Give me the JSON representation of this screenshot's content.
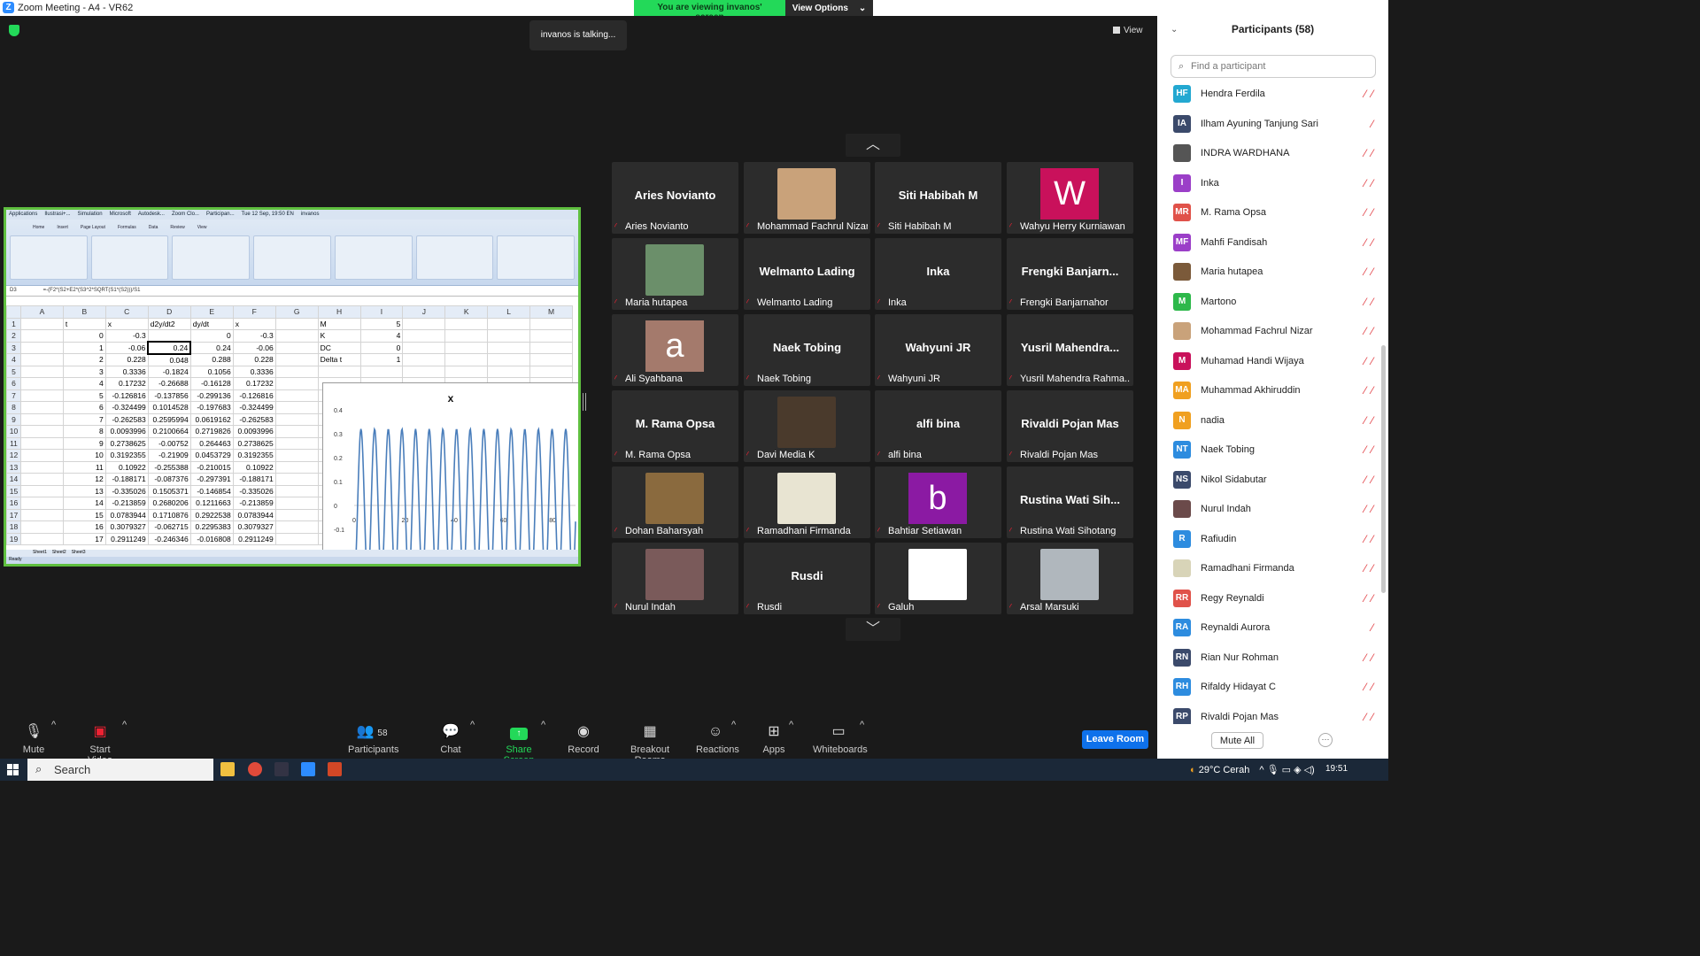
{
  "window": {
    "title": "Zoom Meeting - A4 - VR62",
    "banner_text": "You are viewing invanos' screen",
    "view_options": "View Options"
  },
  "main": {
    "talking": "invanos is talking...",
    "view_label": "View"
  },
  "excel": {
    "taskbar": [
      "Applications",
      "Ilustrasi+...",
      "Simulation",
      "Microsoft",
      "Autodesk...",
      "Zoom Clo...",
      "Participan...",
      "Tue 12 Sep, 19:50 EN",
      "invanos"
    ],
    "ribbon_tabs": [
      "Home",
      "Insert",
      "Page Layout",
      "Formulas",
      "Data",
      "Review",
      "View"
    ],
    "cell_ref": "D3",
    "formula": "=-(F2*(S2+E2*(S3^2*SQRT(S1*(S2)))/S1",
    "columns": [
      "",
      "A",
      "B",
      "C",
      "D",
      "E",
      "F",
      "G",
      "H",
      "I",
      "J",
      "K",
      "L",
      "M"
    ],
    "rows": [
      [
        "1",
        "",
        "t",
        "x",
        "d2y/dt2",
        "dy/dt",
        "x",
        "",
        "M",
        "5",
        "",
        "",
        "",
        ""
      ],
      [
        "2",
        "",
        "0",
        "-0.3",
        "",
        "0",
        "-0.3",
        "",
        "K",
        "4",
        "",
        "",
        "",
        ""
      ],
      [
        "3",
        "",
        "1",
        "-0.06",
        "0.24",
        "0.24",
        "-0.06",
        "",
        "DC",
        "0",
        "",
        "",
        "",
        ""
      ],
      [
        "4",
        "",
        "2",
        "0.228",
        "0.048",
        "0.288",
        "0.228",
        "",
        "Delta t",
        "1",
        "",
        "",
        "",
        ""
      ],
      [
        "5",
        "",
        "3",
        "0.3336",
        "-0.1824",
        "0.1056",
        "0.3336",
        "",
        "",
        "",
        "",
        "",
        "",
        ""
      ],
      [
        "6",
        "",
        "4",
        "0.17232",
        "-0.26688",
        "-0.16128",
        "0.17232",
        "",
        "",
        "",
        "",
        "",
        "",
        ""
      ],
      [
        "7",
        "",
        "5",
        "-0.126816",
        "-0.137856",
        "-0.299136",
        "-0.126816",
        "",
        "",
        "",
        "",
        "",
        "",
        ""
      ],
      [
        "8",
        "",
        "6",
        "-0.324499",
        "0.1014528",
        "-0.197683",
        "-0.324499",
        "",
        "",
        "",
        "",
        "",
        "",
        ""
      ],
      [
        "9",
        "",
        "7",
        "-0.262583",
        "0.2595994",
        "0.0619162",
        "-0.262583",
        "",
        "",
        "",
        "",
        "",
        "",
        ""
      ],
      [
        "10",
        "",
        "8",
        "0.0093996",
        "0.2100664",
        "0.2719826",
        "0.0093996",
        "",
        "",
        "",
        "",
        "",
        "",
        ""
      ],
      [
        "11",
        "",
        "9",
        "0.2738625",
        "-0.00752",
        "0.264463",
        "0.2738625",
        "",
        "",
        "",
        "",
        "",
        "",
        ""
      ],
      [
        "12",
        "",
        "10",
        "0.3192355",
        "-0.21909",
        "0.0453729",
        "0.3192355",
        "",
        "",
        "",
        "",
        "",
        "",
        ""
      ],
      [
        "13",
        "",
        "11",
        "0.10922",
        "-0.255388",
        "-0.210015",
        "0.10922",
        "",
        "",
        "",
        "",
        "",
        "",
        ""
      ],
      [
        "14",
        "",
        "12",
        "-0.188171",
        "-0.087376",
        "-0.297391",
        "-0.188171",
        "",
        "",
        "",
        "",
        "",
        "",
        ""
      ],
      [
        "15",
        "",
        "13",
        "-0.335026",
        "0.1505371",
        "-0.146854",
        "-0.335026",
        "",
        "",
        "",
        "",
        "",
        "",
        ""
      ],
      [
        "16",
        "",
        "14",
        "-0.213859",
        "0.2680206",
        "0.1211663",
        "-0.213859",
        "",
        "",
        "",
        "",
        "",
        "",
        ""
      ],
      [
        "17",
        "",
        "15",
        "0.0783944",
        "0.1710876",
        "0.2922538",
        "0.0783944",
        "",
        "",
        "",
        "",
        "",
        "",
        ""
      ],
      [
        "18",
        "",
        "16",
        "0.3079327",
        "-0.062715",
        "0.2295383",
        "0.3079327",
        "",
        "",
        "",
        "",
        "",
        "",
        ""
      ],
      [
        "19",
        "",
        "17",
        "0.2911249",
        "-0.246346",
        "-0.016808",
        "0.2911249",
        "",
        "",
        "",
        "",
        "",
        "",
        ""
      ]
    ],
    "sheets": [
      "Sheet1",
      "Sheet2",
      "Sheet3"
    ],
    "status": "Ready",
    "chart": {
      "title": "x",
      "y_ticks": [
        "0.4",
        "0.3",
        "0.2",
        "0.1",
        "0",
        "-0.1"
      ],
      "x_ticks": [
        "0",
        "20",
        "40",
        "60",
        "80"
      ]
    }
  },
  "tiles": [
    {
      "name": "Aries Novianto",
      "label": "Aries Novianto",
      "kind": "text"
    },
    {
      "name": "",
      "label": "Mohammad Fachrul Nizar",
      "kind": "pic",
      "color": "#c9a27a"
    },
    {
      "name": "Siti Habibah M",
      "label": "Siti Habibah M",
      "kind": "text"
    },
    {
      "name": "W",
      "label": "Wahyu Herry Kurniawan",
      "kind": "avatar",
      "color": "#c9115b"
    },
    {
      "name": "",
      "label": "Maria hutapea",
      "kind": "pic",
      "color": "#6b8f6a"
    },
    {
      "name": "Welmanto Lading",
      "label": "Welmanto Lading",
      "kind": "text"
    },
    {
      "name": "Inka",
      "label": "Inka",
      "kind": "text"
    },
    {
      "name": "Frengki  Banjarn...",
      "label": "Frengki Banjarnahor",
      "kind": "text"
    },
    {
      "name": "a",
      "label": "Ali Syahbana",
      "kind": "avatar",
      "color": "#a47a6c"
    },
    {
      "name": "Naek Tobing",
      "label": "Naek Tobing",
      "kind": "text"
    },
    {
      "name": "Wahyuni JR",
      "label": "Wahyuni JR",
      "kind": "text"
    },
    {
      "name": "Yusril  Mahendra...",
      "label": "Yusril Mahendra Rahma...",
      "kind": "text"
    },
    {
      "name": "M. Rama Opsa",
      "label": "M. Rama Opsa",
      "kind": "text"
    },
    {
      "name": "",
      "label": "Davi Media K",
      "kind": "pic",
      "color": "#4a3a2c"
    },
    {
      "name": "alfi bina",
      "label": "alfi bina",
      "kind": "text"
    },
    {
      "name": "Rivaldi Pojan Mas",
      "label": "Rivaldi Pojan Mas",
      "kind": "text"
    },
    {
      "name": "",
      "label": "Dohan Baharsyah",
      "kind": "pic",
      "color": "#8a6a3e"
    },
    {
      "name": "",
      "label": "Ramadhani Firmanda",
      "kind": "pic",
      "color": "#e8e4d2"
    },
    {
      "name": "b",
      "label": "Bahtiar Setiawan",
      "kind": "avatar",
      "color": "#8b1aa3"
    },
    {
      "name": "Rustina  Wati  Sih...",
      "label": "Rustina Wati Sihotang",
      "kind": "text"
    },
    {
      "name": "",
      "label": "Nurul Indah",
      "kind": "pic",
      "color": "#7a5a5a"
    },
    {
      "name": "Rusdi",
      "label": "Rusdi",
      "kind": "text"
    },
    {
      "name": "",
      "label": "Galuh",
      "kind": "pic",
      "color": "#ffffff"
    },
    {
      "name": "",
      "label": "Arsal Marsuki",
      "kind": "pic",
      "color": "#b0b7bd"
    }
  ],
  "toolbar": {
    "mute": "Mute",
    "start_video": "Start Video",
    "participants": "Participants",
    "participants_count": "58",
    "chat": "Chat",
    "share_screen": "Share Screen",
    "record": "Record",
    "breakout": "Breakout Rooms",
    "reactions": "Reactions",
    "apps": "Apps",
    "whiteboards": "Whiteboards",
    "leave": "Leave Room"
  },
  "participants_panel": {
    "title": "Participants (58)",
    "search_placeholder": "Find a participant",
    "mute_all": "Mute All",
    "items": [
      {
        "initials": "HF",
        "name": "Hendra Ferdila",
        "color": "#23a8d1"
      },
      {
        "initials": "IA",
        "name": "Ilham Ayuning Tanjung Sari",
        "color": "#3b4a6b"
      },
      {
        "initials": "",
        "name": "INDRA WARDHANA",
        "color": "#555"
      },
      {
        "initials": "I",
        "name": "Inka",
        "color": "#9b3fc8"
      },
      {
        "initials": "MR",
        "name": "M. Rama Opsa",
        "color": "#e0524a"
      },
      {
        "initials": "MF",
        "name": "Mahfi Fandisah",
        "color": "#9b3fc8"
      },
      {
        "initials": "",
        "name": "Maria hutapea",
        "color": "#7b5a3a"
      },
      {
        "initials": "M",
        "name": "Martono",
        "color": "#2db84a"
      },
      {
        "initials": "",
        "name": "Mohammad Fachrul Nizar",
        "color": "#c9a27a"
      },
      {
        "initials": "M",
        "name": "Muhamad Handi Wijaya",
        "color": "#c9115b"
      },
      {
        "initials": "MA",
        "name": "Muhammad Akhiruddin",
        "color": "#f0a020"
      },
      {
        "initials": "N",
        "name": "nadia",
        "color": "#f0a020"
      },
      {
        "initials": "NT",
        "name": "Naek Tobing",
        "color": "#2d8cdf"
      },
      {
        "initials": "NS",
        "name": "Nikol Sidabutar",
        "color": "#3b4a6b"
      },
      {
        "initials": "",
        "name": "Nurul Indah",
        "color": "#6b4a4a"
      },
      {
        "initials": "R",
        "name": "Rafiudin",
        "color": "#2d8cdf"
      },
      {
        "initials": "",
        "name": "Ramadhani Firmanda",
        "color": "#d8d4b8"
      },
      {
        "initials": "RR",
        "name": "Regy Reynaldi",
        "color": "#e0524a"
      },
      {
        "initials": "RA",
        "name": "Reynaldi Aurora",
        "color": "#2d8cdf"
      },
      {
        "initials": "RN",
        "name": "Rian Nur Rohman",
        "color": "#3b4a6b"
      },
      {
        "initials": "RH",
        "name": "Rifaldy Hidayat C",
        "color": "#2d8cdf"
      },
      {
        "initials": "RP",
        "name": "Rivaldi Pojan Mas",
        "color": "#3b4a6b"
      }
    ]
  },
  "taskbar": {
    "search": "Search",
    "weather": "29°C  Cerah",
    "time": "19:51"
  }
}
